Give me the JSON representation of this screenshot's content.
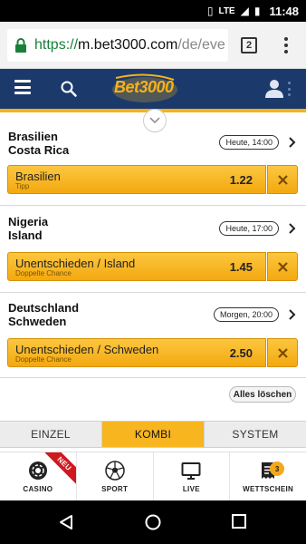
{
  "status_bar": {
    "network": "LTE",
    "time": "11:48"
  },
  "browser": {
    "url_protocol": "https://",
    "url_host": "m.bet3000.com",
    "url_path": "/de/eve",
    "tab_count": "2"
  },
  "site": {
    "logo_text": "Bet3000"
  },
  "bets": [
    {
      "team1": "Brasilien",
      "team2": "Costa Rica",
      "time": "Heute, 14:00",
      "tipp": "Brasilien",
      "tipp_type": "Tipp",
      "odds": "1.22"
    },
    {
      "team1": "Nigeria",
      "team2": "Island",
      "time": "Heute, 17:00",
      "tipp": "Unentschieden / Island",
      "tipp_type": "Doppelte Chance",
      "odds": "1.45"
    },
    {
      "team1": "Deutschland",
      "team2": "Schweden",
      "time": "Morgen, 20:00",
      "tipp": "Unentschieden / Schweden",
      "tipp_type": "Doppelte Chance",
      "odds": "2.50"
    }
  ],
  "clear_all_label": "Alles löschen",
  "bet_modes": {
    "items": [
      "EINZEL",
      "KOMBI",
      "SYSTEM"
    ],
    "active": "KOMBI"
  },
  "bottom_nav": {
    "casino": "CASINO",
    "casino_ribbon": "NEU",
    "sport": "SPORT",
    "live": "LIVE",
    "wettschein": "WETTSCHEIN",
    "wettschein_badge": "3"
  },
  "colors": {
    "header_bg": "#1b3a6b",
    "accent": "#f5b21a",
    "ribbon": "#d0191f"
  }
}
